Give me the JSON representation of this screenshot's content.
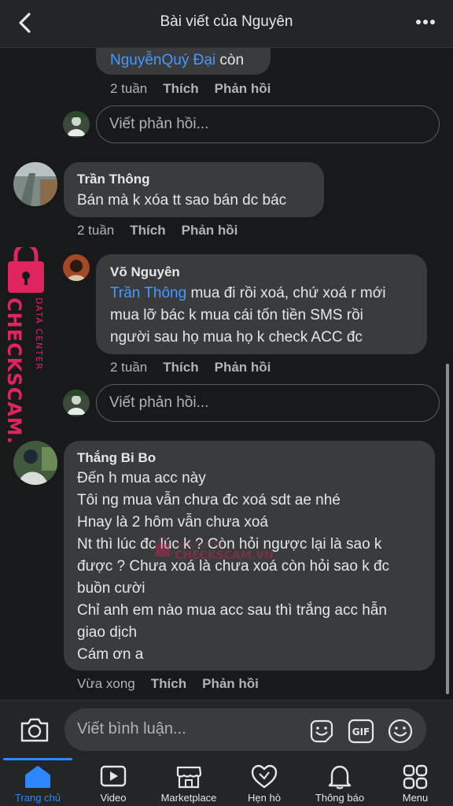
{
  "header": {
    "title": "Bài viết của Nguyên"
  },
  "comments": [
    {
      "author": "",
      "lines": [
        {
          "mention": "NguyễnQuý Đại",
          "text": " còn"
        }
      ],
      "time": "2 tuần",
      "like": "Thích",
      "reply": "Phản hồi"
    },
    {
      "author": "Trần Thông",
      "lines": [
        {
          "text": "Bán mà k xóa tt sao bán dc bác"
        }
      ],
      "time": "2 tuần",
      "like": "Thích",
      "reply": "Phản hồi"
    },
    {
      "author": "Võ Nguyên",
      "lines": [
        {
          "mention": "Trần Thông",
          "text": " mua đi rồi xoá, chứ xoá r mới"
        },
        {
          "text": "mua lỡ bác k mua cái tốn tiền SMS rồi"
        },
        {
          "text": "người sau họ mua họ k check ACC đc"
        }
      ],
      "time": "2 tuần",
      "like": "Thích",
      "reply": "Phản hồi"
    },
    {
      "author": "Thắng Bi Bo",
      "lines": [
        {
          "text": "Đến h mua acc này"
        },
        {
          "text": "Tôi ng mua vẫn chưa đc xoá sdt ae nhé"
        },
        {
          "text": "Hnay là 2 hôm vẫn chưa xoá"
        },
        {
          "text": "Nt thì lúc đc lúc k ? Còn hỏi ngược lại là sao k"
        },
        {
          "text": "được ? Chưa xoá là chưa xoá còn hỏi sao k đc"
        },
        {
          "text": "buồn cười"
        },
        {
          "text": "Chỉ anh em nào mua acc sau thì trắng acc hẫn"
        },
        {
          "text": "giao dịch"
        },
        {
          "text": "Cám ơn a"
        }
      ],
      "time": "Vừa xong",
      "like": "Thích",
      "reply": "Phản hồi"
    }
  ],
  "reply_placeholder": "Viết phản hồi...",
  "composer": {
    "placeholder": "Viết bình luận...",
    "gif_label": "GIF"
  },
  "watermark": {
    "line1": "DATA CENTER",
    "line2": "CHECKSCAM.VN"
  },
  "tabs": [
    {
      "label": "Trang chủ",
      "icon": "home-icon",
      "active": true
    },
    {
      "label": "Video",
      "icon": "video-icon"
    },
    {
      "label": "Marketplace",
      "icon": "marketplace-icon"
    },
    {
      "label": "Hẹn hò",
      "icon": "dating-icon"
    },
    {
      "label": "Thông báo",
      "icon": "bell-icon"
    },
    {
      "label": "Menu",
      "icon": "menu-grid-icon"
    }
  ],
  "colors": {
    "mention": "#4599ff",
    "active_tab": "#2d88ff",
    "watermark": "#e0245e"
  }
}
